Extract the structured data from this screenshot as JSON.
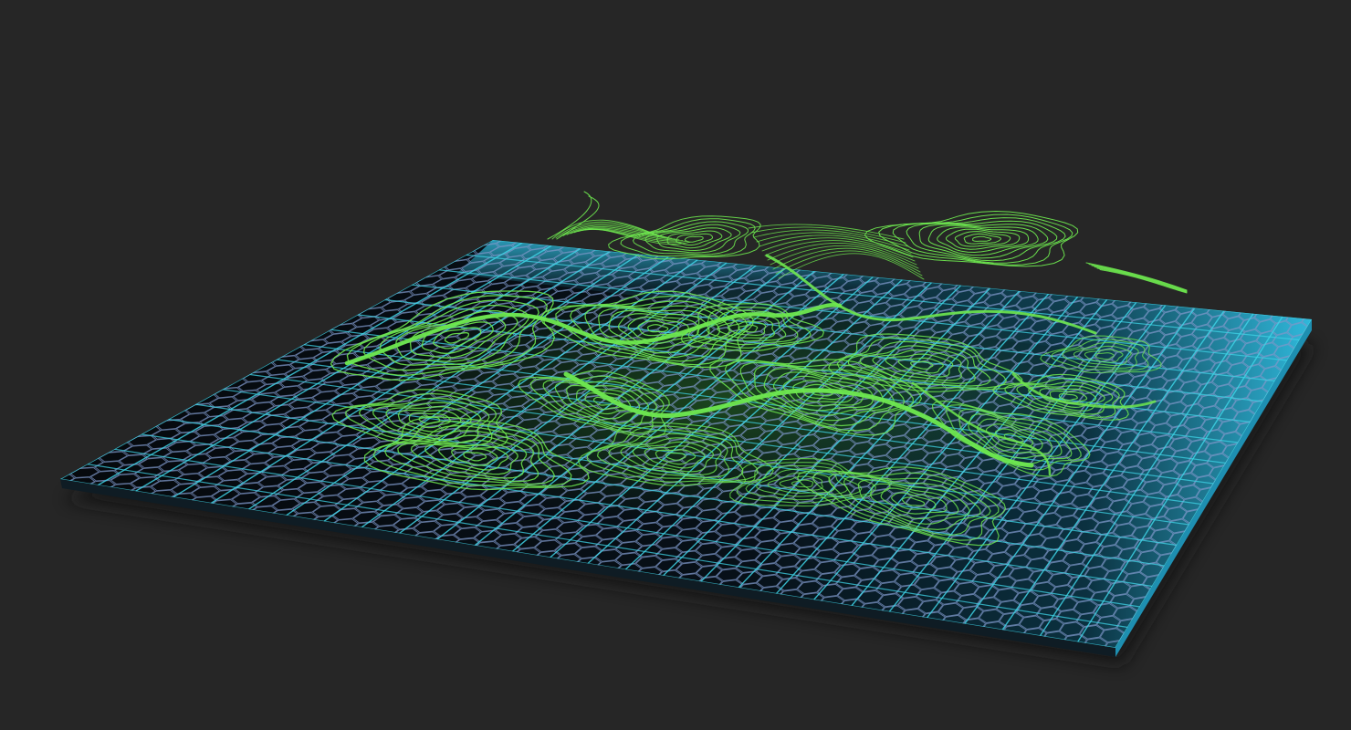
{
  "scene": {
    "description_visible_text": "",
    "colors": {
      "background": "#262626",
      "panel_dark": "#05080c",
      "panel_edge_glow": "#36c8ee",
      "grid_line": "#3fd3e6",
      "hex_line": "#7d97c8",
      "contour_line": "#6ee84f",
      "contour_glow": "#3aa52a",
      "shadow": "#141414"
    },
    "icons": {
      "panel": "hexagon-mesh-panel",
      "overlay": "topographic-contour-lines"
    }
  }
}
